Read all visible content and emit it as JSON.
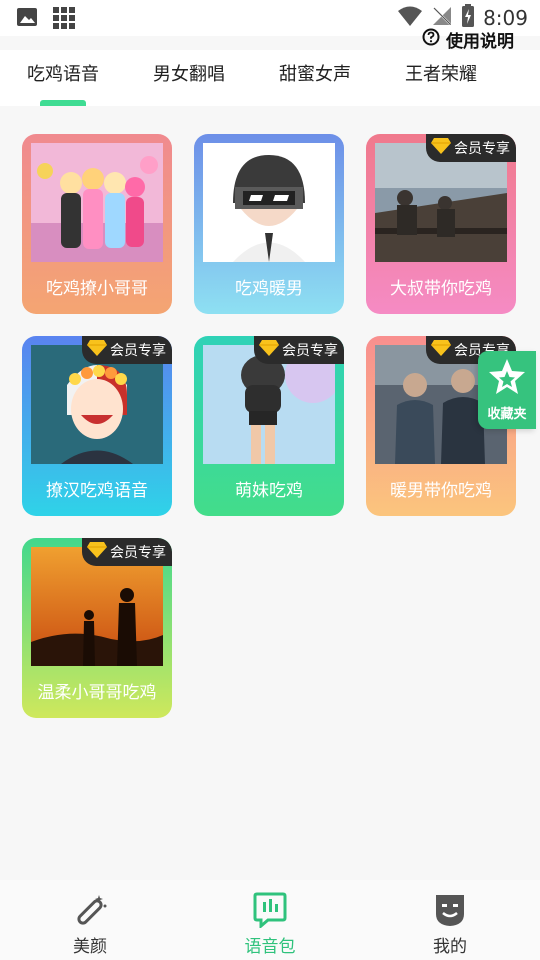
{
  "status_bar": {
    "time": "8:09",
    "left_icons": [
      "image-icon",
      "grid-icon"
    ],
    "right_icons": [
      "wifi-icon",
      "no-signal-icon",
      "battery-charging-icon"
    ]
  },
  "header": {
    "help_label": "使用说明"
  },
  "tabs": [
    {
      "label": "吃鸡语音",
      "active": true
    },
    {
      "label": "男女翻唱",
      "active": false
    },
    {
      "label": "甜蜜女声",
      "active": false
    },
    {
      "label": "王者荣耀",
      "active": false
    }
  ],
  "accent_color": "#3fdc93",
  "vip_label": "会员专享",
  "cards": [
    {
      "title": "吃鸡撩小哥哥",
      "vip": false,
      "gradient": [
        "#f08a8f",
        "#f4a572"
      ]
    },
    {
      "title": "吃鸡暖男",
      "vip": false,
      "gradient": [
        "#6d8fe8",
        "#8ee0f2"
      ]
    },
    {
      "title": "大叔带你吃鸡",
      "vip": true,
      "gradient": [
        "#f0798c",
        "#f58bc4"
      ]
    },
    {
      "title": "撩汉吃鸡语音",
      "vip": true,
      "gradient": [
        "#5a83f0",
        "#2fd3e8"
      ]
    },
    {
      "title": "萌妹吃鸡",
      "vip": true,
      "gradient": [
        "#2fd2b7",
        "#43dd8a"
      ]
    },
    {
      "title": "暖男带你吃鸡",
      "vip": true,
      "gradient": [
        "#f98f8f",
        "#fbc57d"
      ]
    },
    {
      "title": "温柔小哥哥吃鸡",
      "vip": true,
      "gradient": [
        "#42d88d",
        "#cfe85c"
      ]
    }
  ],
  "favorites": {
    "label": "收藏夹"
  },
  "bottom_nav": [
    {
      "label": "美颜",
      "icon": "magic-wand-icon",
      "active": false
    },
    {
      "label": "语音包",
      "icon": "voice-pack-icon",
      "active": true
    },
    {
      "label": "我的",
      "icon": "face-icon",
      "active": false
    }
  ]
}
